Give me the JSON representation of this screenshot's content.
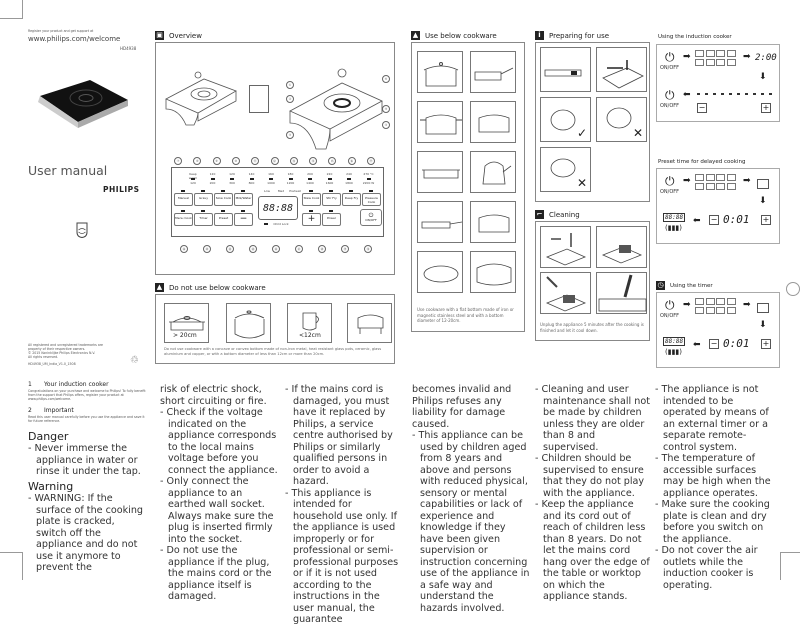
{
  "cover": {
    "register_text": "Register your product and get support at",
    "url": "www.philips.com/welcome",
    "model": "HD4938",
    "title": "User manual",
    "brand": "PHILIPS",
    "legal": [
      "All registered and unregistered trademarks are",
      "property of their respective owners.",
      "© 2015 Koninklijke Philips Electronics N.V.",
      "All rights reserved."
    ],
    "doc_code": "HD4938_UM_India_V1.0_1508",
    "recycle_icon": "recycle-icon",
    "shield_icon": "philips-shield-icon"
  },
  "sections": {
    "s1": {
      "num": "1",
      "title": "Your induction cooker",
      "text": "Congratulations on your purchase and welcome to Philips! To fully benefit from the support that Philips offers, register your product at www.philips.com/welcome."
    },
    "s2": {
      "num": "2",
      "title": "Important",
      "text": "Read this user manual carefully before you use the appliance and save it for future reference."
    },
    "danger": {
      "title": "Danger",
      "items": [
        "Never immerse the appliance in water or rinse it under the tap."
      ]
    },
    "warning": {
      "title": "Warning",
      "items": [
        "WARNING: If the surface of the cooking plate is cracked, switch off the appliance and do not use it anymore to prevent the"
      ]
    }
  },
  "columns": [
    {
      "lines": [
        {
          "b": false,
          "t": "risk of electric shock, short circuiting or fire."
        },
        {
          "b": true,
          "t": "Check if the voltage indicated on the appliance corresponds to the local mains voltage before you connect the appliance."
        },
        {
          "b": true,
          "t": "Only connect the appliance to an earthed wall socket. Always make sure the plug is inserted firmly into the socket."
        },
        {
          "b": true,
          "t": "Do not use the appliance if the plug, the mains cord or the appliance itself is damaged."
        }
      ]
    },
    {
      "lines": [
        {
          "b": true,
          "t": "If the mains cord is damaged, you must have it replaced by Philips, a service centre authorised by Philips or similarly qualified persons in order to avoid a hazard."
        },
        {
          "b": true,
          "t": "This appliance is intended for household use only. If the appliance is used improperly or for professional or semi-professional purposes or if it is not used according to the instructions in the user manual, the guarantee"
        }
      ]
    },
    {
      "lines": [
        {
          "b": false,
          "t": "becomes invalid and Philips refuses any liability for damage caused."
        },
        {
          "b": true,
          "t": "This appliance can be used by children aged from 8 years and above and persons with reduced physical, sensory or mental capabilities or lack of experience and knowledge if they have been given supervision or instruction concerning use of the appliance in a safe way and understand the hazards involved."
        }
      ]
    },
    {
      "lines": [
        {
          "b": true,
          "t": "Cleaning and user maintenance shall not be made by children unless they are older than 8 and supervised."
        },
        {
          "b": true,
          "t": "Children should be supervised to ensure that they do not play with the appliance."
        },
        {
          "b": true,
          "t": "Keep the appliance and its cord out of reach of children less than 8 years. Do not let the mains cord hang over the edge of the table or worktop on which the appliance stands."
        }
      ]
    },
    {
      "lines": [
        {
          "b": true,
          "t": "The appliance is not intended to be operated by means of an external timer or a separate remote-control system."
        },
        {
          "b": true,
          "t": "The temperature of accessible surfaces may be high when the appliance operates."
        },
        {
          "b": true,
          "t": "Make sure the cooking plate is clean and dry before you switch on the appliance."
        },
        {
          "b": true,
          "t": "Do not cover the air outlets while the induction cooker is operating."
        }
      ]
    }
  ],
  "overview": {
    "heading": "Overview",
    "callouts": [
      "①",
      "②",
      "③",
      "④",
      "⑤",
      "⑥"
    ],
    "top_numbers": [
      "⑦",
      "⑧",
      "⑨",
      "⑩",
      "⑪",
      "⑫",
      "⑬",
      "⑭",
      "⑮",
      "⑯",
      "⑰"
    ],
    "bottom_numbers": [
      "㉖",
      "㉕",
      "㉔",
      "㉓",
      "㉒",
      "㉑",
      "⑳",
      "⑲",
      "⑱"
    ],
    "temps": [
      {
        "top": "Keep warm",
        "bot": "120"
      },
      {
        "top": "120",
        "bot": "200"
      },
      {
        "top": "120",
        "bot": "300"
      },
      {
        "top": "140",
        "bot": "800"
      },
      {
        "top": "160",
        "bot": "1000"
      },
      {
        "top": "180",
        "bot": "1200"
      },
      {
        "top": "200",
        "bot": "1400"
      },
      {
        "top": "220",
        "bot": "1600"
      },
      {
        "top": "240",
        "bot": "1800"
      },
      {
        "top": "270 °C",
        "bot": "2200 W"
      }
    ],
    "row1_buttons": [
      "Manual",
      "Gravy",
      "Slow Cook",
      "Milk/Water",
      "Stew Cook",
      "Stir Fry",
      "Deep Fry",
      "Pressure Cook"
    ],
    "level_labels": [
      "Low",
      "Med",
      "Preheat"
    ],
    "row2_buttons": [
      "Menu Cook",
      "Timer",
      "Preset",
      "−",
      "+",
      "Power"
    ],
    "display": "88:88",
    "child_lock": "Child Lock",
    "onoff": "ON/OFF"
  },
  "do_not_use": {
    "heading": "Do not use below cookware",
    "labels": [
      "> 20cm",
      "",
      "<12cm",
      ""
    ],
    "caption": "Do not use cookware with a concave or convex bottom made of non-iron metal, heat resistant glass pots, ceramic, glass aluminium and copper, or with a bottom diameter of less than 12cm or more than 20cm."
  },
  "use_below": {
    "heading": "Use below cookware",
    "caption": "Use cookware with a flat bottom made of iron or magnetic stainless steel and with a bottom diameter of 12-20cm."
  },
  "preparing": {
    "heading": "Preparing for use",
    "check": "✓",
    "cross": "✕"
  },
  "cleaning": {
    "heading": "Cleaning",
    "caption": "Unplug the appliance 5 minutes after the cooking is finished and let it cool down."
  },
  "using_cooker": {
    "heading": "Using the induction cooker",
    "onoff": "ON/OFF",
    "display": "2:00",
    "minus": "−",
    "plus": "+"
  },
  "preset": {
    "heading": "Preset time for delayed cooking",
    "onoff": "ON/OFF",
    "display": "0:01",
    "blink": "88:88",
    "minus": "−",
    "plus": "+"
  },
  "timer": {
    "heading": "Using the timer",
    "onoff": "ON/OFF",
    "display": "0:01",
    "blink": "88:88",
    "minus": "−",
    "plus": "+"
  },
  "colors": {
    "text": "#333333",
    "heading_icon": "#222222",
    "border": "#888888",
    "cooktop": "#111111"
  }
}
